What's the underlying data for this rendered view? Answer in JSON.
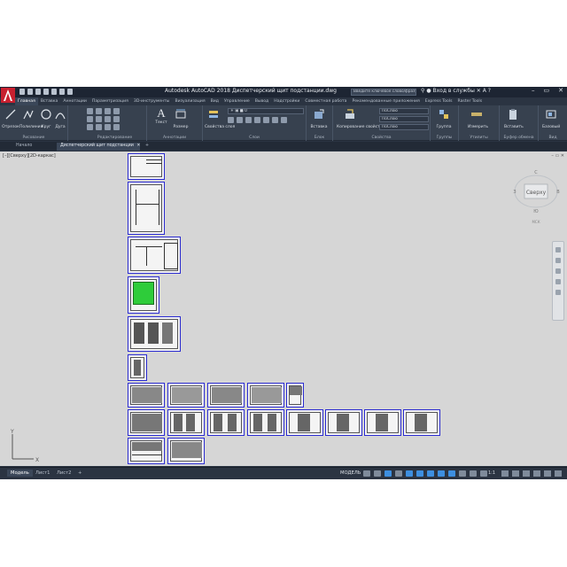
{
  "title_bar": {
    "title": "Autodesk AutoCAD 2018   Диспетчерский щит подстанции.dwg",
    "search_placeholder": "Введите ключевое слово/фразу",
    "user": "Вход в службы",
    "logo_letter": "A"
  },
  "ribbon_tabs": [
    "Главная",
    "Вставка",
    "Аннотации",
    "Параметризация",
    "3D-инструменты",
    "Визуализация",
    "Вид",
    "Управление",
    "Вывод",
    "Надстройки",
    "Совместная работа",
    "Рекомендованные приложения",
    "Express Tools",
    "Raster Tools"
  ],
  "ribbon": {
    "draw": {
      "label": "Рисование",
      "buttons": [
        "Отрезок",
        "Полилиния",
        "Круг",
        "Дуга"
      ]
    },
    "modify": {
      "label": "Редактирование"
    },
    "annotation": {
      "label": "Аннотации",
      "buttons": [
        "Текст",
        "Размер"
      ]
    },
    "layers": {
      "label": "Слои",
      "button": "Свойства слоя"
    },
    "block": {
      "label": "Блок",
      "button": "Вставка"
    },
    "properties": {
      "label": "Свойства",
      "match_button": "Копирование свойств",
      "bylayer1": "ПоСлою",
      "bylayer2": "ПоСлою",
      "bylayer3": "ПоСлою"
    },
    "groups": {
      "label": "Группы",
      "button": "Группа"
    },
    "utilities": {
      "label": "Утилиты",
      "button": "Измерить"
    },
    "clipboard": {
      "label": "Буфер обмена",
      "button": "Вставить"
    },
    "view": {
      "label": "Вид",
      "button": "Базовый"
    }
  },
  "doc_tabs": [
    "Начало",
    "Диспетчерский щит подстанции"
  ],
  "drawing": {
    "viewport_label": "[–][Сверху][2D-каркас]",
    "viewcube_label": "Сверху",
    "viewcube_compass": {
      "north": "С",
      "west": "З",
      "east": "В",
      "south": "Ю"
    },
    "viewcube_wcs": "МСК",
    "ucs_x": "X",
    "ucs_y": "Y"
  },
  "layout_tabs": [
    "Модель",
    "Лист1",
    "Лист2"
  ],
  "status_bar": {
    "model_label": "МОДЕЛЬ",
    "scale": "1:1"
  }
}
